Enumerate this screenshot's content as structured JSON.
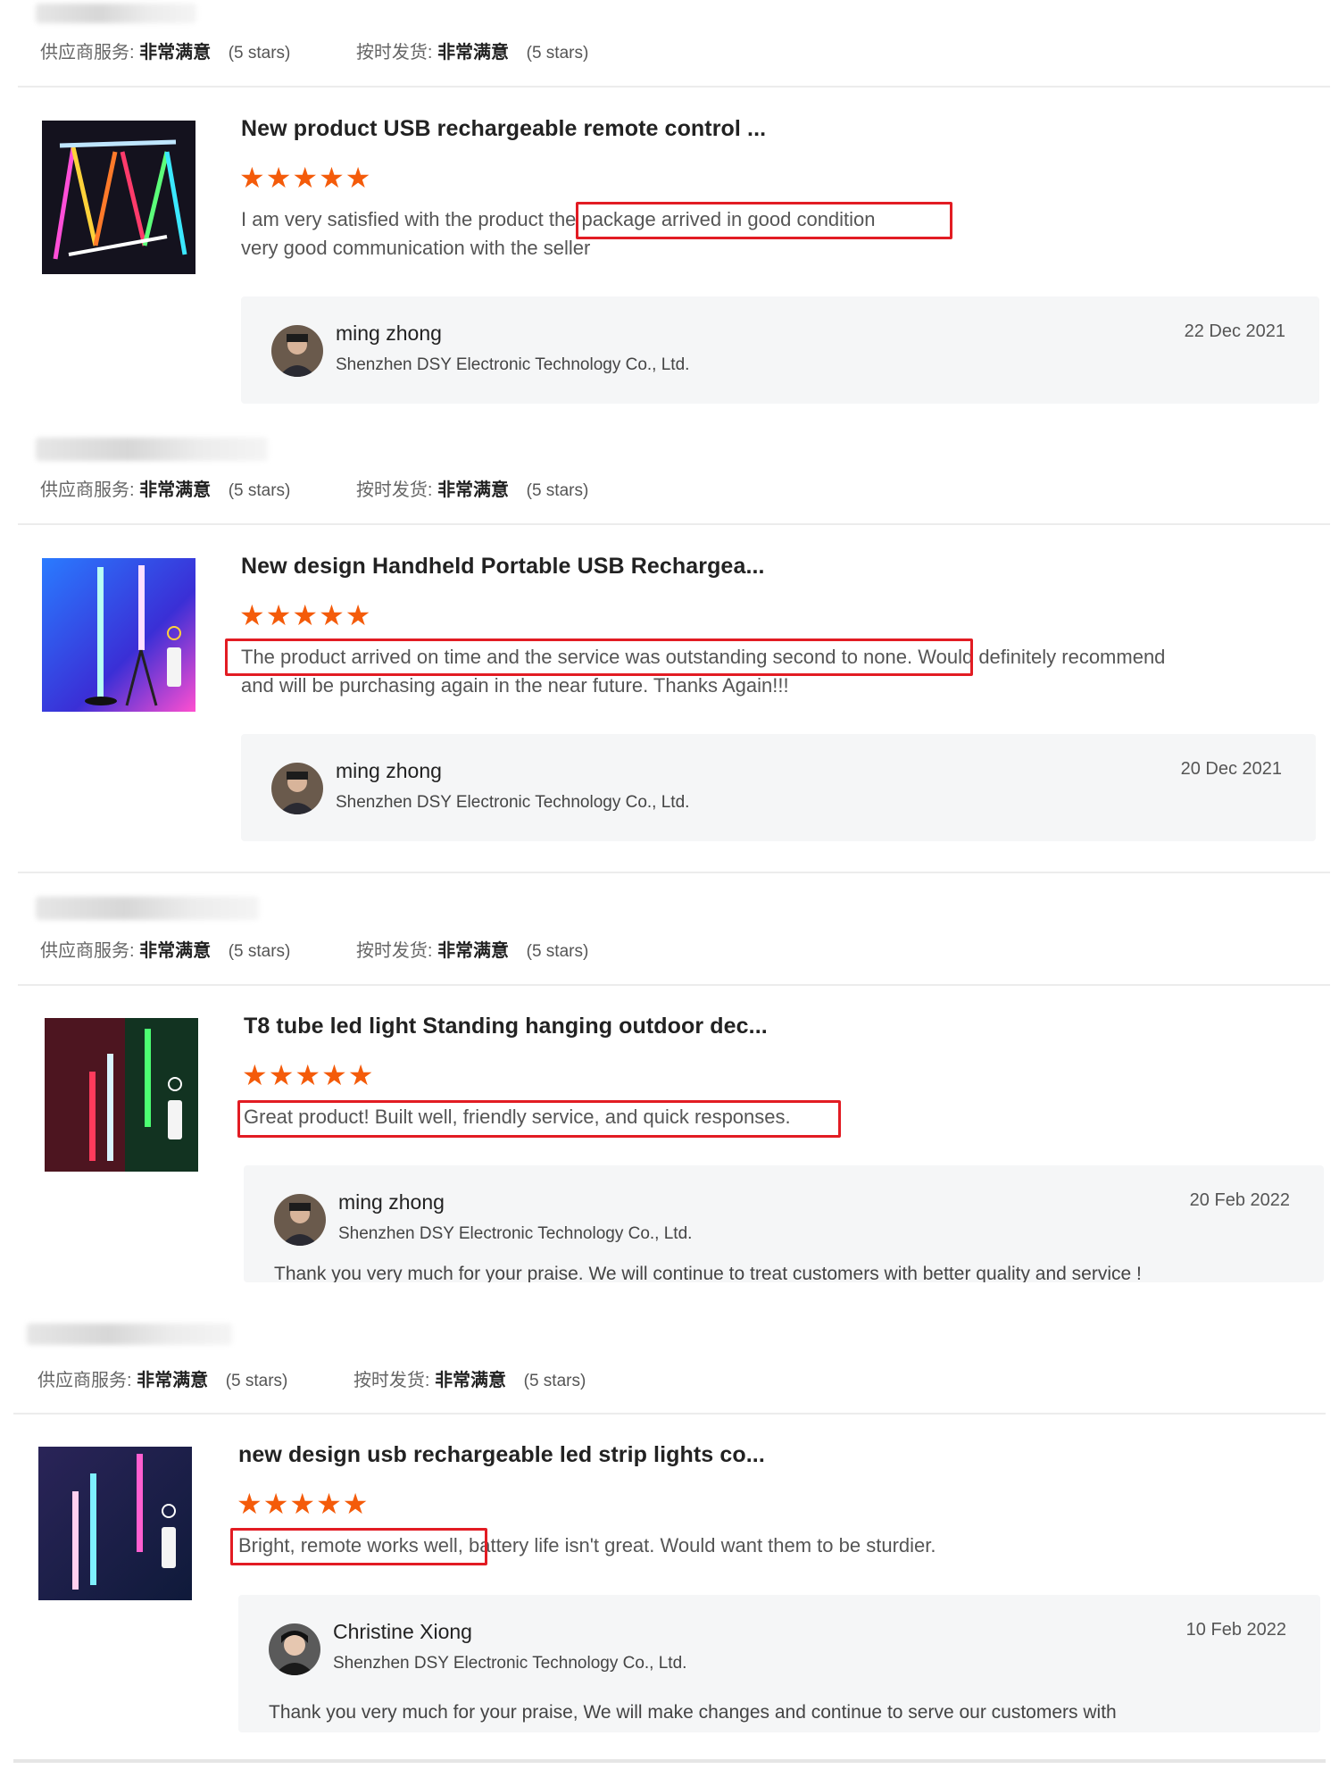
{
  "rating_labels": {
    "supplier_service": "供应商服务:",
    "on_time_shipment": "按时发货:",
    "rating_value": "非常满意",
    "stars_text": "(5 stars)"
  },
  "reviews": [
    {
      "product_title": "New product USB rechargeable remote control ...",
      "star_count": 5,
      "stars": "★★★★★",
      "text_line1_before": "I am very satisfied with the product",
      "text_line1_highlight": "the package arrived in good condition",
      "text_line1_after": "",
      "text_line2": "very good communication with the seller",
      "reply_name": "ming zhong",
      "reply_company": "Shenzhen DSY Electronic Technology Co., Ltd.",
      "reply_date": "22 Dec 2021",
      "reply_text": ""
    },
    {
      "product_title": "New design Handheld Portable USB Rechargea...",
      "star_count": 5,
      "stars": "★★★★★",
      "text_line1_before": "",
      "text_line1_highlight": "The product arrived on time and the service was outstanding second to none.",
      "text_line1_after": "Would definitely recommend",
      "text_line2": "and will be purchasing again in the near future. Thanks Again!!!",
      "reply_name": "ming zhong",
      "reply_company": "Shenzhen DSY Electronic Technology Co., Ltd.",
      "reply_date": "20 Dec 2021",
      "reply_text": ""
    },
    {
      "product_title": "T8 tube led light Standing hanging outdoor dec...",
      "star_count": 5,
      "stars": "★★★★★",
      "text_line1_before": "",
      "text_line1_highlight": "Great product! Built well, friendly service, and quick responses.",
      "text_line1_after": "",
      "text_line2": "",
      "reply_name": "ming zhong",
      "reply_company": "Shenzhen DSY Electronic Technology Co., Ltd.",
      "reply_date": "20 Feb 2022",
      "reply_text": "Thank you very much for your praise. We will continue to treat customers with better quality and service !"
    },
    {
      "product_title": "new design usb rechargeable led strip lights co...",
      "star_count": 5,
      "stars": "★★★★★",
      "text_line1_before": "",
      "text_line1_highlight": "Bright, remote works well,",
      "text_line1_after": "battery life isn't great. Would want them to be sturdier.",
      "text_line2": "",
      "reply_name": "Christine Xiong",
      "reply_company": "Shenzhen DSY Electronic Technology Co., Ltd.",
      "reply_date": "10 Feb 2022",
      "reply_text": "Thank you very much for your praise, We will make changes and continue to serve our customers with"
    }
  ],
  "colors": {
    "star": "#f45b0a",
    "highlight_border": "#e21c23",
    "reply_bg": "#f5f6f7"
  }
}
